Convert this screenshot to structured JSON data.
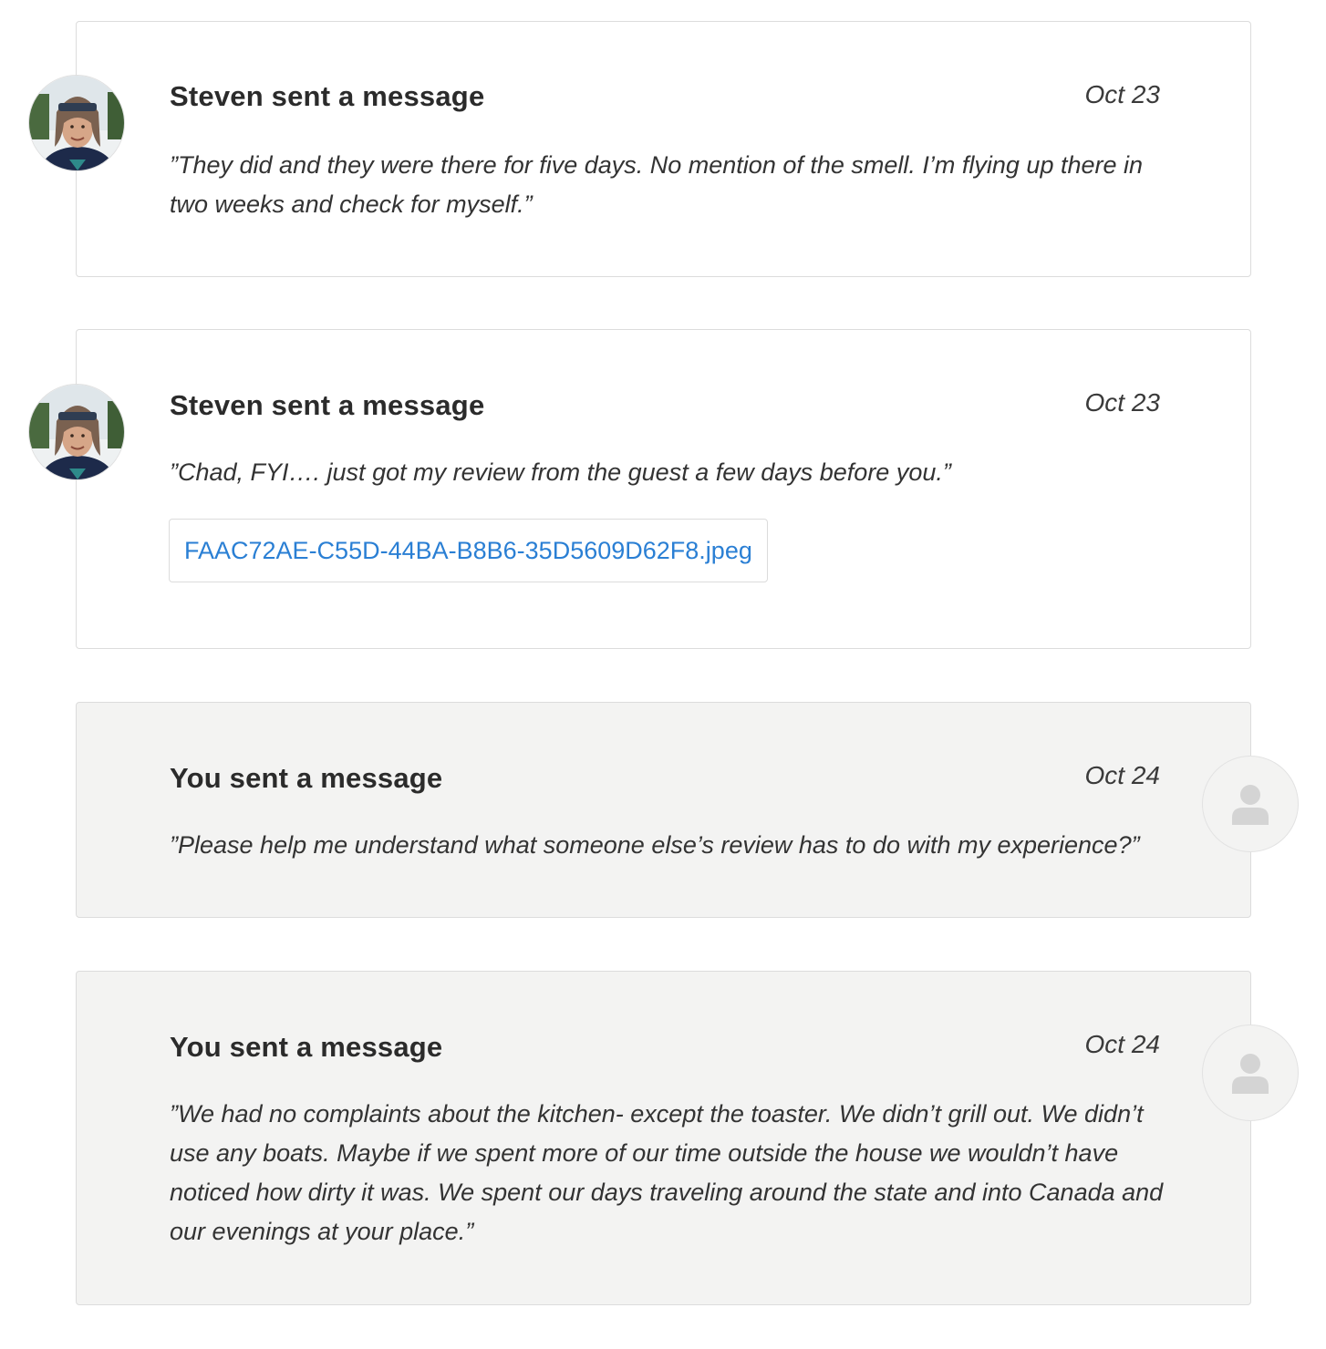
{
  "messages": [
    {
      "title": "Steven sent a message",
      "date": "Oct 23",
      "body": "”They did and they were there for five days. No mention of the smell. I’m flying up there in two weeks and check for myself.”"
    },
    {
      "title": "Steven sent a message",
      "date": "Oct 23",
      "body": "”Chad, FYI…. just got my review from the guest a few days before you.”",
      "attachment": "FAAC72AE-C55D-44BA-B8B6-35D5609D62F8.jpeg"
    },
    {
      "title": "You sent a message",
      "date": "Oct 24",
      "body": "”Please help me understand what someone else’s review has to do with my experience?”"
    },
    {
      "title": "You sent a message",
      "date": "Oct 24",
      "body": "”We had no complaints about the kitchen- except the toaster. We didn’t grill out. We didn’t use any boats. Maybe if we spent more of our time outside the house we wouldn’t have noticed how dirty it was. We spent our days traveling around the state and into Canada and our evenings at your place.”"
    }
  ],
  "colors": {
    "link": "#2a7fd4",
    "own_card_bg": "#f3f3f2",
    "border": "#dcdcdc"
  },
  "icons": {
    "sender_avatar": "user-photo-avatar",
    "own_avatar": "person-placeholder-icon"
  }
}
